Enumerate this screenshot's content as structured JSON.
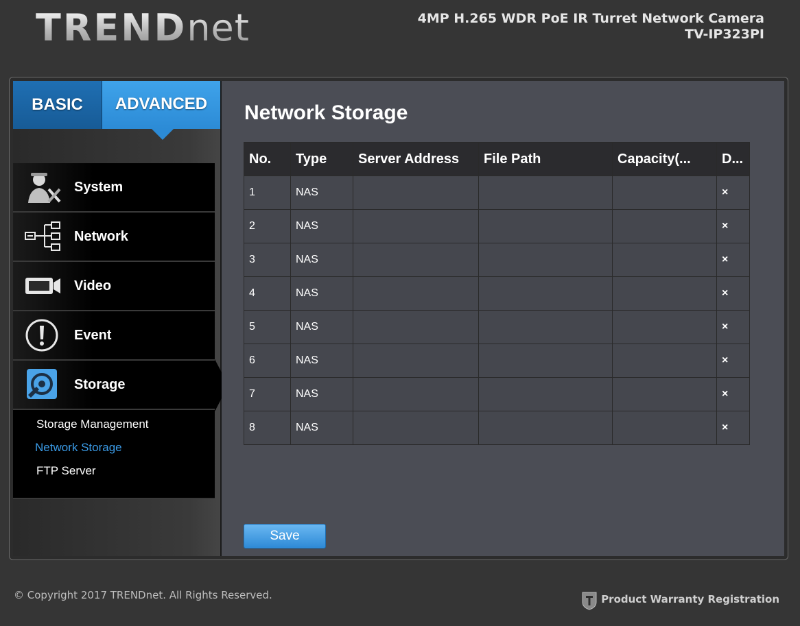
{
  "header": {
    "logo_main": "TREND",
    "logo_thin": "net",
    "product_line1": "4MP H.265 WDR PoE IR Turret Network Camera",
    "product_line2": "TV-IP323PI"
  },
  "tabs": [
    {
      "label": "BASIC",
      "active": false
    },
    {
      "label": "ADVANCED",
      "active": true
    }
  ],
  "sidebar": {
    "items": [
      {
        "label": "System",
        "icon": "system-admin-icon"
      },
      {
        "label": "Network",
        "icon": "network-tree-icon"
      },
      {
        "label": "Video",
        "icon": "video-camera-icon"
      },
      {
        "label": "Event",
        "icon": "exclamation-icon"
      },
      {
        "label": "Storage",
        "icon": "storage-icon"
      }
    ],
    "storage_submenu": [
      {
        "label": "Storage Management",
        "active": false
      },
      {
        "label": "Network Storage",
        "active": true
      },
      {
        "label": "FTP Server",
        "active": false
      }
    ]
  },
  "main": {
    "title": "Network Storage",
    "table": {
      "headers": [
        "No.",
        "Type",
        "Server Address",
        "File Path",
        "Capacity(...",
        "D..."
      ],
      "rows": [
        {
          "no": "1",
          "type": "NAS",
          "server": "",
          "path": "",
          "capacity": ""
        },
        {
          "no": "2",
          "type": "NAS",
          "server": "",
          "path": "",
          "capacity": ""
        },
        {
          "no": "3",
          "type": "NAS",
          "server": "",
          "path": "",
          "capacity": ""
        },
        {
          "no": "4",
          "type": "NAS",
          "server": "",
          "path": "",
          "capacity": ""
        },
        {
          "no": "5",
          "type": "NAS",
          "server": "",
          "path": "",
          "capacity": ""
        },
        {
          "no": "6",
          "type": "NAS",
          "server": "",
          "path": "",
          "capacity": ""
        },
        {
          "no": "7",
          "type": "NAS",
          "server": "",
          "path": "",
          "capacity": ""
        },
        {
          "no": "8",
          "type": "NAS",
          "server": "",
          "path": "",
          "capacity": ""
        }
      ],
      "delete_icon": "×"
    },
    "save_label": "Save"
  },
  "footer": {
    "copyright": "© Copyright 2017 TRENDnet. All Rights Reserved.",
    "warranty": "Product Warranty Registration"
  },
  "colors": {
    "accent_blue": "#2c8bd6",
    "active_link": "#3b9ce8",
    "delete_red": "#e32626",
    "content_bg": "#4b4d55"
  }
}
